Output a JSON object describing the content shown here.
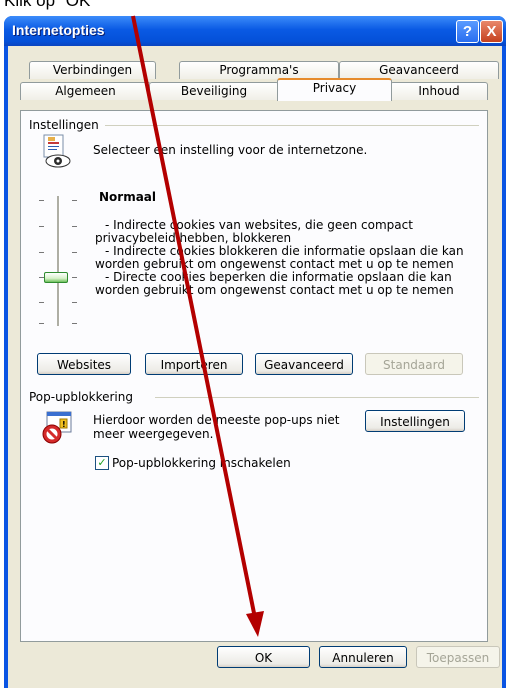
{
  "caption": "Klik op \"OK\"",
  "window": {
    "title": "Internetopties",
    "help_glyph": "?",
    "close_glyph": "X"
  },
  "tabs_back": [
    "Verbindingen",
    "Programma's",
    "Geavanceerd"
  ],
  "tabs_front": [
    "Algemeen",
    "Beveiliging",
    "Privacy",
    "Inhoud"
  ],
  "settings": {
    "group_label": "Instellingen",
    "zone_text": "Selecteer een instelling voor de internetzone.",
    "level_title": "Normaal",
    "level_desc": [
      "- Indirecte cookies van websites, die geen compact",
      "privacybeleid hebben, blokkeren",
      "- Indirecte cookies blokkeren die informatie opslaan die kan",
      "worden gebruikt om ongewenst contact met u op te nemen",
      "- Directe cookies beperken die informatie opslaan die kan",
      "worden gebruikt om ongewenst contact met u op te nemen"
    ],
    "slider_level": 3,
    "buttons": {
      "websites": "Websites",
      "import": "Importeren",
      "advanced": "Geavanceerd",
      "default": "Standaard"
    }
  },
  "popup": {
    "group_label": "Pop-upblokkering",
    "desc": [
      "Hierdoor worden de meeste pop-ups niet",
      "meer weergegeven."
    ],
    "settings_button": "Instellingen",
    "enable_label": "Pop-upblokkering inschakelen",
    "enabled": true
  },
  "dialog_buttons": {
    "ok": "OK",
    "cancel": "Annuleren",
    "apply": "Toepassen"
  },
  "colors": {
    "arrow": "#b30000",
    "titlebar": "#0a54e3",
    "dialog_bg": "#ece9d8"
  }
}
